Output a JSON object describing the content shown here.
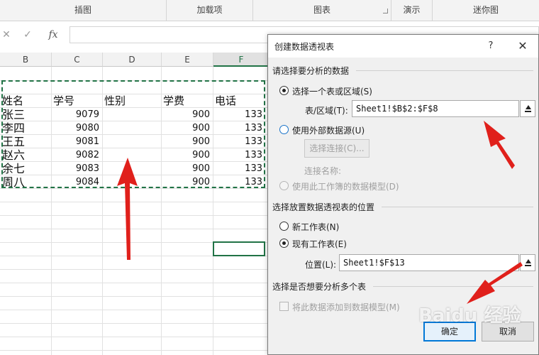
{
  "ribbon": {
    "groups": [
      "插图",
      "加载项",
      "图表",
      "演示",
      "迷你图"
    ]
  },
  "formula_bar": {
    "cancel_glyph": "✕",
    "enter_glyph": "✓",
    "function_label": "fx"
  },
  "sheet": {
    "columns": [
      "B",
      "C",
      "D",
      "E",
      "F"
    ],
    "selected_column": "F",
    "header_row": [
      "姓名",
      "学号",
      "性别",
      "学费",
      "电话"
    ],
    "rows": [
      {
        "name": "张三",
        "id": "9079",
        "fee": "900",
        "phone": "133"
      },
      {
        "name": "李四",
        "id": "9080",
        "fee": "900",
        "phone": "133"
      },
      {
        "name": "王五",
        "id": "9081",
        "fee": "900",
        "phone": "133"
      },
      {
        "name": "赵六",
        "id": "9082",
        "fee": "900",
        "phone": "133"
      },
      {
        "name": "余七",
        "id": "9083",
        "fee": "900",
        "phone": "133"
      },
      {
        "name": "周八",
        "id": "9084",
        "fee": "900",
        "phone": "133"
      }
    ]
  },
  "dialog": {
    "title": "创建数据透视表",
    "help_glyph": "?",
    "close_glyph": "✕",
    "section_choose_data": "请选择要分析的数据",
    "option_table_range": "选择一个表或区域(S)",
    "table_range_label": "表/区域(T):",
    "table_range_value": "Sheet1!$B$2:$F$8",
    "option_external": "使用外部数据源(U)",
    "choose_connection_button": "选择连接(C)...",
    "connection_name_label": "连接名称:",
    "option_data_model": "使用此工作簿的数据模型(D)",
    "section_placement": "选择放置数据透视表的位置",
    "option_new_sheet": "新工作表(N)",
    "option_existing_sheet": "现有工作表(E)",
    "location_label": "位置(L):",
    "location_value": "Sheet1!$F$13",
    "section_multiple_tables": "选择是否想要分析多个表",
    "add_to_model_label": "将此数据添加到数据模型(M)",
    "ok_button": "确定",
    "cancel_button": "取消"
  },
  "watermark": "Baidu 经验",
  "colors": {
    "excel_green": "#217346",
    "annotation_red": "#e0201b",
    "focus_blue": "#0078d7"
  }
}
